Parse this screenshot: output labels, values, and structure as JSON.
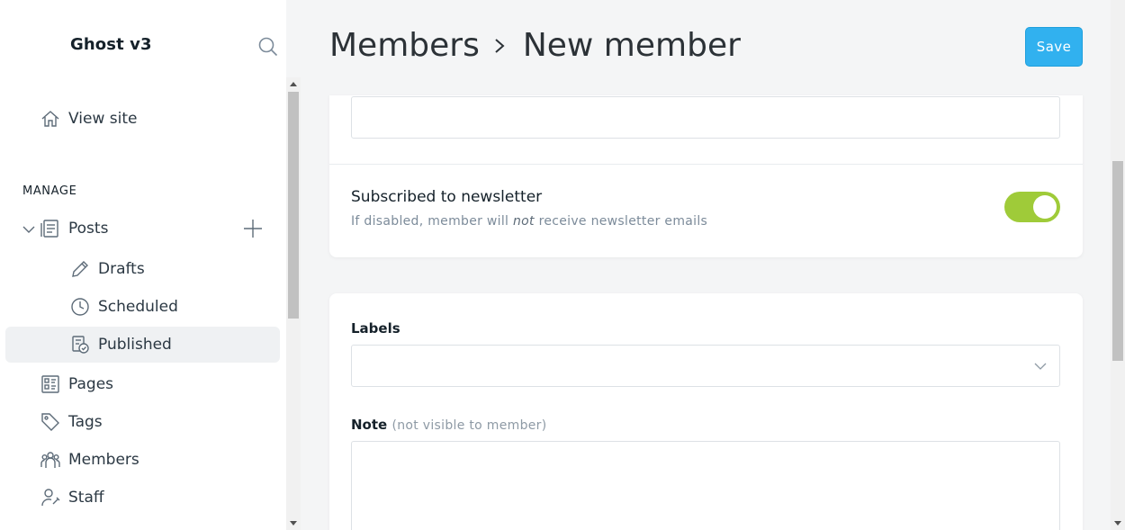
{
  "sidebar": {
    "site_title": "Ghost v3",
    "view_site": "View site",
    "manage_label": "MANAGE",
    "items": {
      "posts": "Posts",
      "drafts": "Drafts",
      "scheduled": "Scheduled",
      "published": "Published",
      "pages": "Pages",
      "tags": "Tags",
      "members": "Members",
      "staff": "Staff"
    }
  },
  "header": {
    "breadcrumb_parent": "Members",
    "breadcrumb_current": "New member",
    "save_label": "Save"
  },
  "newsletter": {
    "title": "Subscribed to newsletter",
    "hint_before": "If disabled, member will ",
    "hint_emphasis": "not",
    "hint_after": " receive newsletter emails",
    "enabled": true
  },
  "labels_field": {
    "label": "Labels",
    "value": ""
  },
  "note_field": {
    "label": "Note",
    "sublabel": "(not visible to member)",
    "value": ""
  },
  "colors": {
    "accent": "#31b1ef",
    "toggle_on": "#9fcb39"
  }
}
